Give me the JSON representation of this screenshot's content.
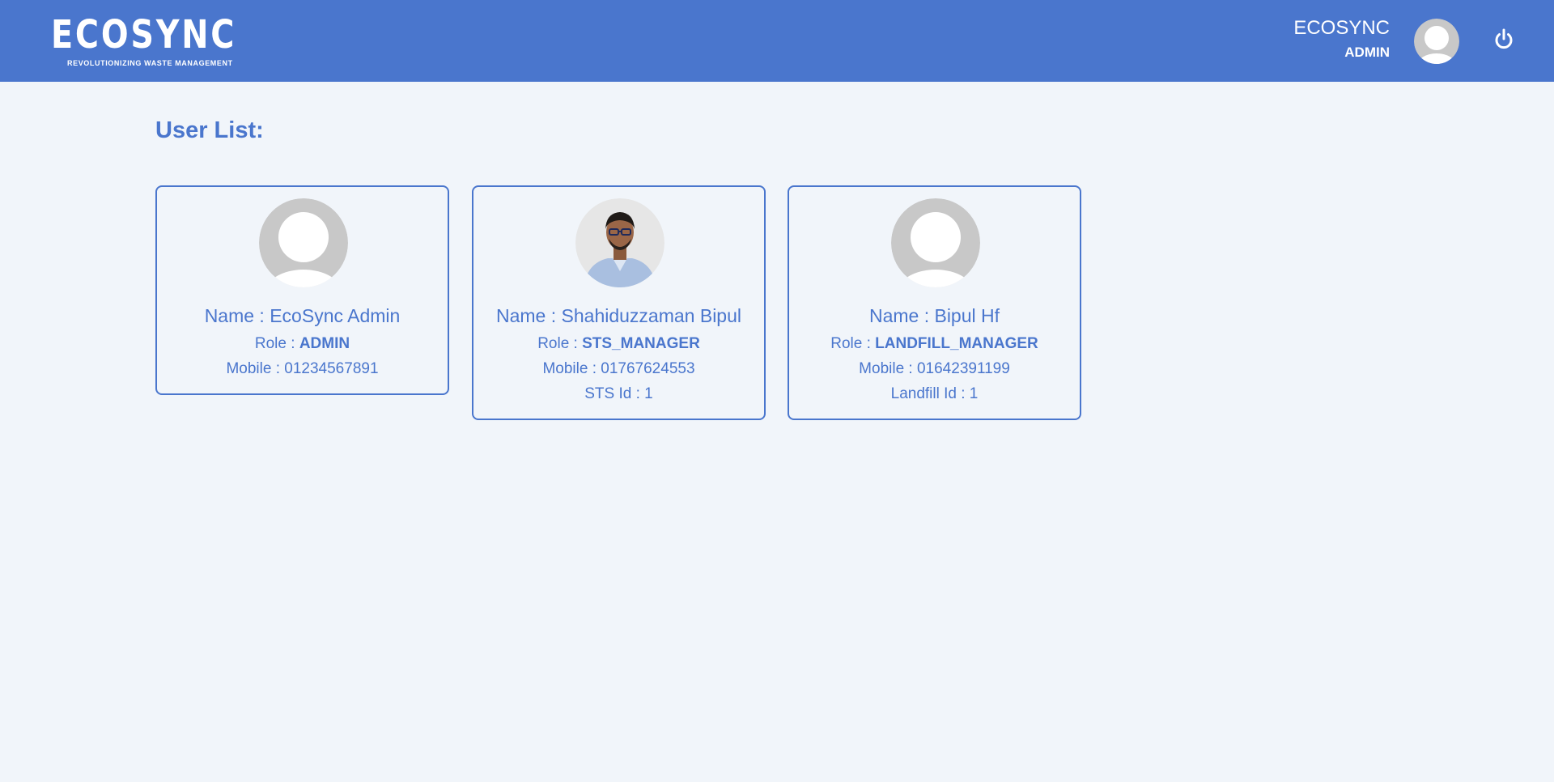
{
  "header": {
    "logo_text": "ECOSYNC",
    "logo_tagline": "REVOLUTIONIZING WASTE MANAGEMENT",
    "user_name": "ECOSYNC",
    "user_role": "ADMIN",
    "avatar_icon": "default-user-avatar",
    "power_icon": "power-icon",
    "bar_color": "#4a76cd"
  },
  "page": {
    "title": "User List:"
  },
  "users": [
    {
      "name_prefix": "Name : ",
      "name": "EcoSync Admin",
      "role_prefix": "Role : ",
      "role": "ADMIN",
      "mobile_prefix": "Mobile : ",
      "mobile": "01234567891",
      "avatar": "default-user-avatar"
    },
    {
      "name_prefix": "Name : ",
      "name": "Shahiduzzaman Bipul",
      "role_prefix": "Role : ",
      "role": "STS_MANAGER",
      "mobile_prefix": "Mobile : ",
      "mobile": "01767624553",
      "extra_prefix": "STS Id : ",
      "extra": "1",
      "avatar": "user-photo"
    },
    {
      "name_prefix": "Name : ",
      "name": "Bipul Hf",
      "role_prefix": "Role : ",
      "role": "LANDFILL_MANAGER",
      "mobile_prefix": "Mobile : ",
      "mobile": "01642391199",
      "extra_prefix": "Landfill Id : ",
      "extra": "1",
      "avatar": "default-user-avatar"
    }
  ]
}
